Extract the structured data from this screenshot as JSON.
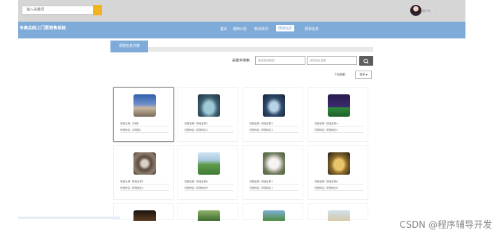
{
  "search": {
    "placeholder": "输入关键词"
  },
  "header": {
    "username": "用户名",
    "caret": "⌄"
  },
  "nav": {
    "brand": "冬奥会网上门票销售系统",
    "items": [
      "首页",
      "通知公告",
      "新闻资讯",
      "场馆信息",
      "赛事信息"
    ],
    "active_index": 3
  },
  "section": {
    "title": "场馆信息列表"
  },
  "filter": {
    "keyword_label": "关键字搜索:",
    "name_placeholder": "场馆名称搜索",
    "area_placeholder": "场馆地区搜索",
    "sort_label": "下拉搜索:",
    "sort_button": "排序 ▾"
  },
  "venues": [
    {
      "name": "场馆名称: 2场馆",
      "area": "场馆地区: 2场馆区",
      "selected": true
    },
    {
      "name": "场馆名称: 场馆名称2",
      "area": "场馆地区: 场馆地区2"
    },
    {
      "name": "场馆名称: 场馆名称3",
      "area": "场馆地区: 场馆地区3"
    },
    {
      "name": "场馆名称: 场馆名称4",
      "area": "场馆地区: 场馆地区4"
    },
    {
      "name": "场馆名称: 场馆名称5",
      "area": "场馆地区: 场馆地区5"
    },
    {
      "name": "场馆名称: 场馆名称6",
      "area": "场馆地区: 场馆地区6"
    },
    {
      "name": "场馆名称: 场馆名称7",
      "area": "场馆地区: 场馆地区7"
    },
    {
      "name": "场馆名称: 场馆名称8",
      "area": "场馆地区: 场馆地区8"
    }
  ],
  "watermark": "CSDN @程序辅导开发",
  "colors": {
    "nav": "#7fabd9",
    "search_button": "#f2b320",
    "topbar": "#d6d6d6"
  }
}
